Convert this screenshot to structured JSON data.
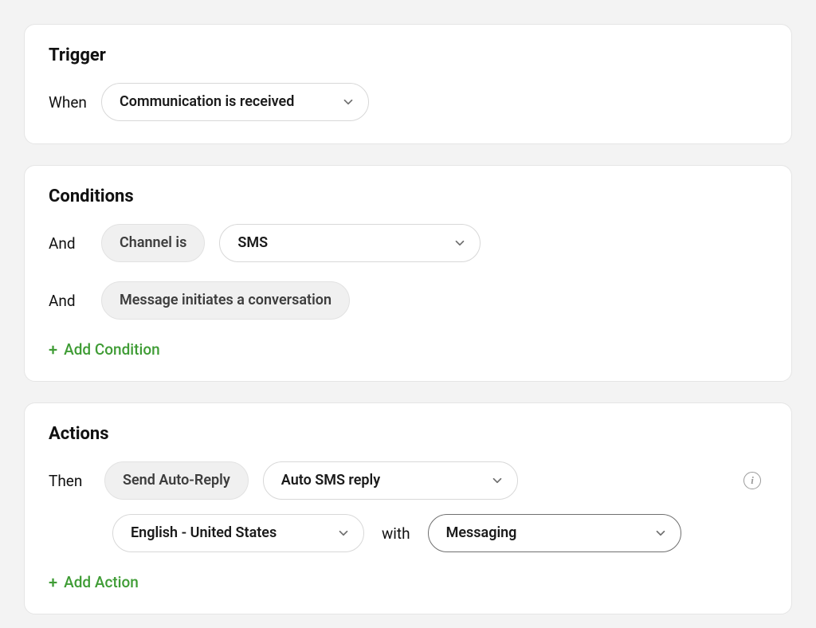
{
  "trigger": {
    "title": "Trigger",
    "prefix": "When",
    "select": "Communication is received"
  },
  "conditions": {
    "title": "Conditions",
    "rows": [
      {
        "prefix": "And",
        "chip": "Channel is",
        "select": "SMS"
      },
      {
        "prefix": "And",
        "chip": "Message initiates a conversation"
      }
    ],
    "add_label": "Add Condition"
  },
  "actions": {
    "title": "Actions",
    "prefix": "Then",
    "chip": "Send Auto-Reply",
    "template_select": "Auto SMS reply",
    "language_select": "English - United States",
    "midword": "with",
    "service_select": "Messaging",
    "add_label": "Add Action"
  }
}
